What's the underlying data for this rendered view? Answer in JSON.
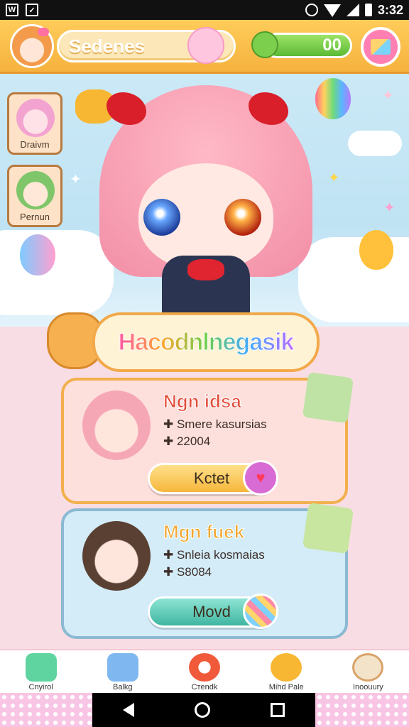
{
  "status_bar": {
    "time": "3:32"
  },
  "header": {
    "title": "Sedenes",
    "score": "00"
  },
  "side_cards": [
    {
      "label": "Draivm"
    },
    {
      "label": "Pernun"
    }
  ],
  "banner": {
    "text": "Hacodnlnegasik"
  },
  "cards": [
    {
      "title": "Ngn idsa",
      "line1": "✚ Smere kasursias",
      "line2": "✚ 22004",
      "button": "Kctet",
      "button_icon": "heart-icon"
    },
    {
      "title": "Mgn fuek",
      "line1": "✚ Snleia kosmaias",
      "line2": "✚ S8084",
      "button": "Movd",
      "button_icon": "candy-ball-icon"
    }
  ],
  "bottom_nav": [
    {
      "label": "Cnyirol",
      "icon": "gem-icon",
      "color": "#5fd3a0"
    },
    {
      "label": "Balkg",
      "icon": "bag-icon",
      "color": "#7fb8f0"
    },
    {
      "label": "Cтendk",
      "icon": "target-icon",
      "color": "#f05a3a"
    },
    {
      "label": "Mihd Pale",
      "icon": "smile-icon",
      "color": "#f7b733"
    },
    {
      "label": "Inoouury",
      "icon": "hat-icon",
      "color": "#d9a36a"
    }
  ]
}
